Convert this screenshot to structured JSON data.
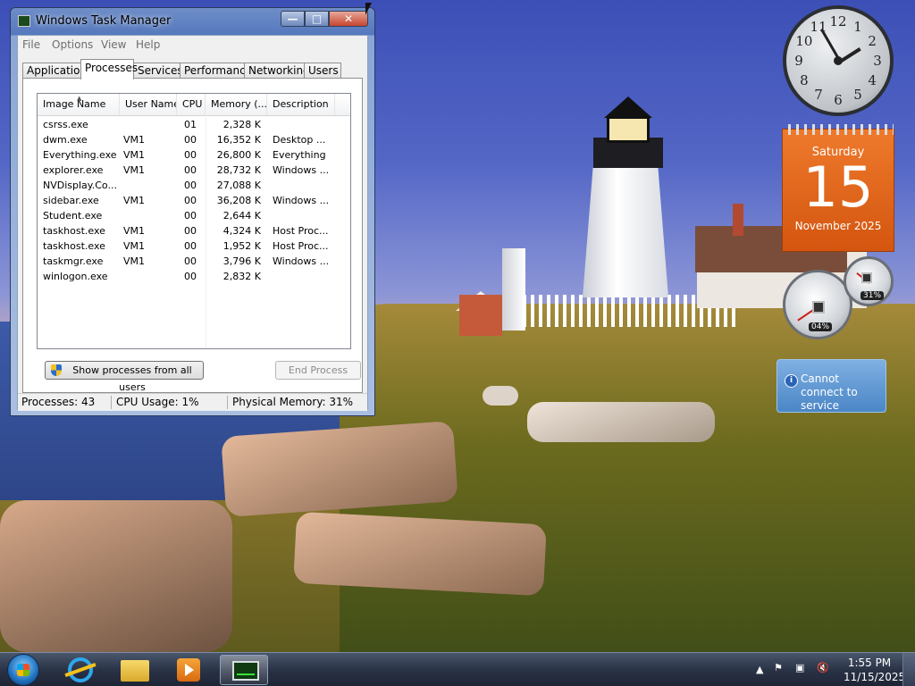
{
  "window": {
    "title": "Windows Task Manager",
    "menu": [
      "File",
      "Options",
      "View",
      "Help"
    ],
    "tabs": [
      "Applications",
      "Processes",
      "Services",
      "Performance",
      "Networking",
      "Users"
    ],
    "active_tab": "Processes",
    "columns": [
      "Image Name",
      "User Name",
      "CPU",
      "Memory (...",
      "Description"
    ],
    "rows": [
      {
        "name": "csrss.exe",
        "user": "",
        "cpu": "01",
        "mem": "2,328 K",
        "desc": ""
      },
      {
        "name": "dwm.exe",
        "user": "VM1",
        "cpu": "00",
        "mem": "16,352 K",
        "desc": "Desktop ..."
      },
      {
        "name": "Everything.exe",
        "user": "VM1",
        "cpu": "00",
        "mem": "26,800 K",
        "desc": "Everything"
      },
      {
        "name": "explorer.exe",
        "user": "VM1",
        "cpu": "00",
        "mem": "28,732 K",
        "desc": "Windows ..."
      },
      {
        "name": "NVDisplay.Co...",
        "user": "",
        "cpu": "00",
        "mem": "27,088 K",
        "desc": ""
      },
      {
        "name": "sidebar.exe",
        "user": "VM1",
        "cpu": "00",
        "mem": "36,208 K",
        "desc": "Windows ..."
      },
      {
        "name": "Student.exe",
        "user": "",
        "cpu": "00",
        "mem": "2,644 K",
        "desc": ""
      },
      {
        "name": "taskhost.exe",
        "user": "VM1",
        "cpu": "00",
        "mem": "4,324 K",
        "desc": "Host Proc..."
      },
      {
        "name": "taskhost.exe",
        "user": "VM1",
        "cpu": "00",
        "mem": "1,952 K",
        "desc": "Host Proc..."
      },
      {
        "name": "taskmgr.exe",
        "user": "VM1",
        "cpu": "00",
        "mem": "3,796 K",
        "desc": "Windows ..."
      },
      {
        "name": "winlogon.exe",
        "user": "",
        "cpu": "00",
        "mem": "2,832 K",
        "desc": ""
      }
    ],
    "show_all_label": "Show processes from all users",
    "end_process_label": "End Process",
    "status": {
      "processes": "Processes: 43",
      "cpu": "CPU Usage: 1%",
      "memory": "Physical Memory: 31%"
    }
  },
  "gadgets": {
    "calendar": {
      "day": "Saturday",
      "date": "15",
      "month": "November 2025"
    },
    "meter": {
      "cpu": "04%",
      "memory": "31%",
      "cpu_value": 4,
      "memory_value": 31
    },
    "message": "Cannot connect to service",
    "clock_numbers": [
      "12",
      "1",
      "2",
      "3",
      "4",
      "5",
      "6",
      "7",
      "8",
      "9",
      "10",
      "11"
    ]
  },
  "taskbar": {
    "time": "1:55 PM",
    "date": "11/15/2025"
  }
}
